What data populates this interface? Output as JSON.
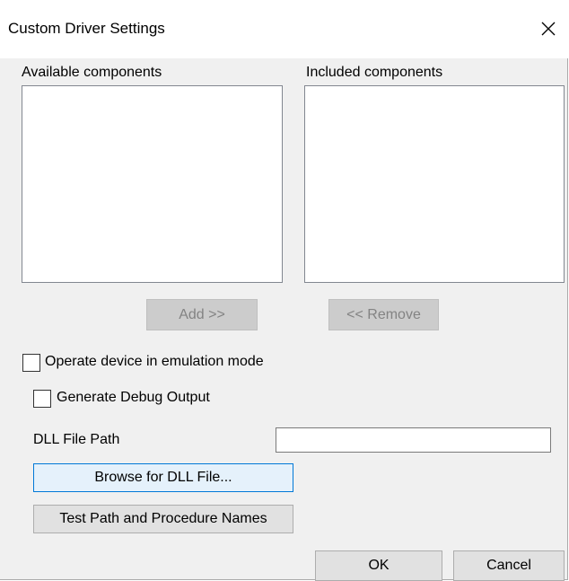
{
  "window": {
    "title": "Custom Driver Settings",
    "close_icon": "close-icon"
  },
  "components": {
    "available_label": "Available components",
    "included_label": "Included components",
    "available_items": [],
    "included_items": [],
    "add_button": "Add >>",
    "remove_button": "<< Remove"
  },
  "options": {
    "emulation_label": "Operate device in emulation mode",
    "emulation_checked": false,
    "debug_label": "Generate Debug Output",
    "debug_checked": false
  },
  "dll": {
    "path_label": "DLL File Path",
    "path_value": "",
    "browse_button": "Browse for DLL File...",
    "test_button": "Test Path and Procedure Names"
  },
  "footer": {
    "ok_button": "OK",
    "cancel_button": "Cancel"
  },
  "colors": {
    "accent": "#0078d7",
    "dialog_bg": "#f0f0f0",
    "disabled_text": "#838383"
  }
}
